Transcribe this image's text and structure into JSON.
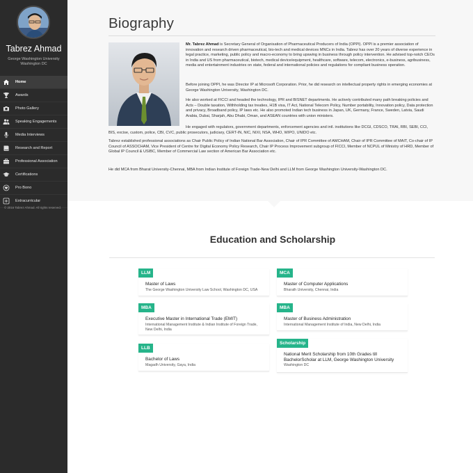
{
  "sidebar": {
    "name": "Tabrez Ahmad",
    "subtitle": "George Washington University Washington DC",
    "nav": [
      {
        "label": "Home",
        "icon": "home-icon",
        "active": true
      },
      {
        "label": "Awards",
        "icon": "trophy-icon",
        "active": false
      },
      {
        "label": "Photo Gallery",
        "icon": "camera-icon",
        "active": false
      },
      {
        "label": "Speaking Engagements",
        "icon": "users-icon",
        "active": false
      },
      {
        "label": "Media Interviews",
        "icon": "microphone-icon",
        "active": false
      },
      {
        "label": "Research and Report",
        "icon": "book-icon",
        "active": false
      },
      {
        "label": "Professional Association",
        "icon": "briefcase-icon",
        "active": false
      },
      {
        "label": "Certifications",
        "icon": "graduation-cap-icon",
        "active": false
      },
      {
        "label": "Pro Bono",
        "icon": "heart-icon",
        "active": false
      },
      {
        "label": "Extracurricular",
        "icon": "plus-square-icon",
        "active": false
      }
    ],
    "copyright": "© 2016 Tabrez Ahmad. All rights reserved."
  },
  "biography": {
    "title": "Biography",
    "p1_name": "Mr. Tabrez Ahmad",
    "p1_rest": " is Secretary General of Organisation of Pharmaceutical Producers of India (OPPI). OPPI is a premier association of innovation and research driven pharmaceutical, bio-tech and medical devices MNCs in India. Tabrez has over 20 years of diverse experience in legal practice, marketing, public policy and macro-economy to bring upswing in business through policy intervention. He advised top-notch CEOs in India and US from pharmaceutical, biotech, medical device/equipment, healthcare, software, telecom, electronics, e-business, agribusiness, media and entertainment industries on state, federal and international policies and regulations for compliant business operation.",
    "p2": "Before joining OPPI, he was Director IP at Microsoft Corporation. Prior, he did research on intellectual property rights in emerging economies at George Washington University, Washington DC.",
    "p3": "He also worked at FICCI and headed the technology, IPR and BISNET departments. He actively contributed many path breaking policies and Acts – Double taxation, Withholding tax treaties, H1B visa, IT Act, National Telecom Policy, Number portability, Innovation policy, Data protection and privacy, Broadband policy, IP laws etc. He also promoted Indian tech business in Japan, UK, Germany, France, Sweden, Latvia, Saudi Arabia, Dubai, Sharjah, Abu Dhabi, Oman, and ASEAN countries with union ministers.",
    "p4": "He engaged with regulators, government departments, enforcement agencies and intl. institutions like DCGI, CDSCO, TRAI, RBI, SEBI, CCI, BIS, excise, custom, police, CBI, CVC, public prosecutors, judiciary, CERT-IN, NIC, NIXI, NSA, WHO, WIPO, UNIDO etc.",
    "p5": "Tabrez established professional associations as Chair Public Policy of Indian National Bar Association, Chair of IPR Committee of AMCHAM, Chair of IPR Committee of MAIT, Co-chair of IP Council of ASSOCHAM, Vice President of Centre for Digital Economy Policy Research, Chair IP Process Improvement subgroup of FICCI, Member of NCPUL of Ministry of HRD, Member of Global IP Council & USIBC, Member of Commercial Law section of American Bar Association etc.",
    "p6": "He did MCA from Bharat University-Chennai, MBA from Indian Institute of Foreign Trade-New Delhi and LLM from George Washington University-Washington DC."
  },
  "education": {
    "title": "Education and Scholarship",
    "accent": "#26b48a",
    "items": [
      {
        "badge": "LLM",
        "degree": "Master of Laws",
        "institution": "The George Washington University Law School, Washington DC, USA"
      },
      {
        "badge": "MCA",
        "degree": "Master of Computer Applications",
        "institution": "Bharath University, Chennai, India"
      },
      {
        "badge": "MBA",
        "degree": "Executive Master in International Trade (EMIT)",
        "institution": "International Management Institute & Indian Institute of Foreign Trade, New Delhi, India"
      },
      {
        "badge": "MBA",
        "degree": "Master of Business Administration",
        "institution": "International Management Institute of India, New Delhi, India"
      },
      {
        "badge": "LLB",
        "degree": "Bachelor of Laws",
        "institution": "Magadh University, Gaya, India"
      },
      {
        "badge": "Scholarship",
        "degree": "National Merit Scholarship from 10th Grades till BachelorScholar at LLM, George Washington University",
        "institution": "Washington DC"
      }
    ]
  }
}
